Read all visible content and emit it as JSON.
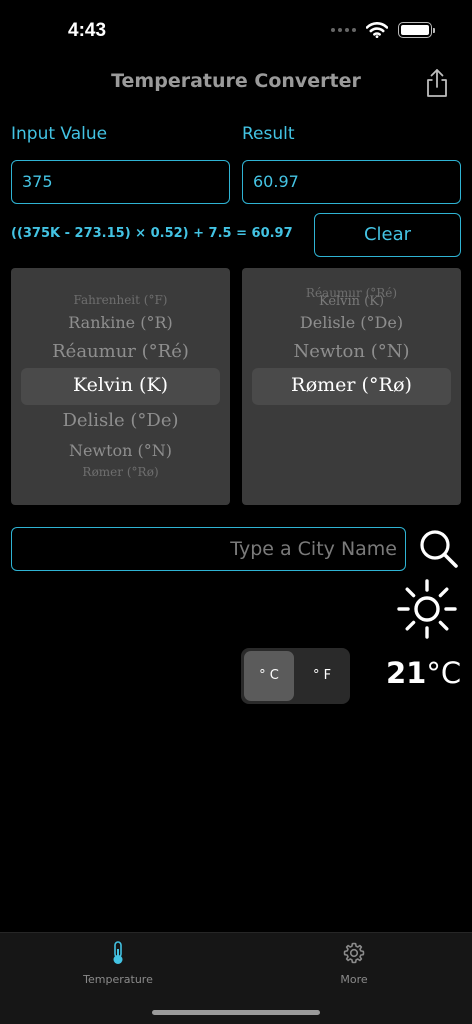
{
  "status_bar": {
    "time": "4:43"
  },
  "nav": {
    "title": "Temperature Converter"
  },
  "input": {
    "label": "Input Value",
    "value": "375"
  },
  "result": {
    "label": "Result",
    "value": "60.97"
  },
  "formula": "((375K - 273.15) × 0.52) + 7.5 = 60.97",
  "clear_label": "Clear",
  "from_picker": {
    "items": [
      "Fahrenheit (°F)",
      "Rankine (°R)",
      "Réaumur (°Ré)",
      "Kelvin (K)",
      "Delisle (°De)",
      "Newton (°N)",
      "Rømer (°Rø)"
    ],
    "selected": "Kelvin (K)"
  },
  "to_picker": {
    "items": [
      "Réaumur (°Ré)",
      "Kelvin (K)",
      "Delisle (°De)",
      "Newton (°N)",
      "Rømer (°Rø)"
    ],
    "selected": "Rømer (°Rø)"
  },
  "city": {
    "placeholder": "Type a City Name"
  },
  "weather": {
    "temperature": "21",
    "unit": "°C",
    "icon": "sun-icon",
    "toggle": {
      "celsius_label": "° C",
      "fahrenheit_label": "° F",
      "selected": "celsius"
    }
  },
  "tabs": [
    {
      "label": "Temperature",
      "icon": "thermometer-icon",
      "active": true
    },
    {
      "label": "More",
      "icon": "gear-icon",
      "active": false
    }
  ],
  "colors": {
    "accent": "#43c3e3",
    "background": "#000000",
    "picker_bg": "#3b3b3b"
  }
}
